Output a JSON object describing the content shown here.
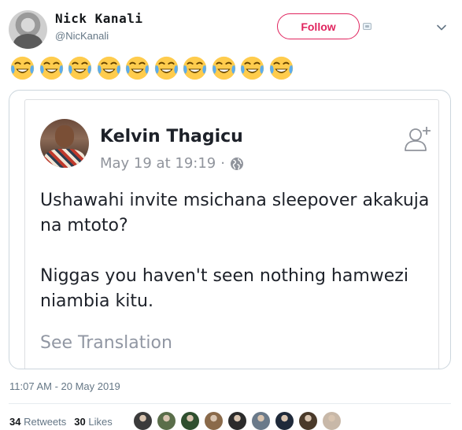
{
  "tweet": {
    "author": {
      "display_name": "Nick Kanali",
      "handle": "@NicKanali"
    },
    "follow_label": "Follow",
    "emoji": {
      "name": "face-with-tears-of-joy-icon",
      "count": 10
    },
    "timestamp": "11:07 AM - 20 May 2019",
    "stats": {
      "retweets_count": "34",
      "retweets_label": "Retweets",
      "likes_count": "30",
      "likes_label": "Likes"
    },
    "liker_avatar_colors": [
      "#3b3b3b",
      "#5a6e4a",
      "#2f4f2f",
      "#8a6a4a",
      "#2b2b2b",
      "#6a7a8a",
      "#1f2a3a",
      "#4a3a2a",
      "#c8b8a8"
    ]
  },
  "quoted_post": {
    "author_name": "Kelvin Thagicu",
    "time": "May 19 at 19:19",
    "separator": "·",
    "paragraphs": [
      "Ushawahi invite msichana sleepover akakuja na mtoto?",
      "Niggas you haven't seen nothing hamwezi niambia kitu."
    ],
    "see_translation": "See Translation"
  },
  "colors": {
    "follow_accent": "#e0245e",
    "secondary_text": "#657786",
    "fb_secondary": "#90949c"
  }
}
